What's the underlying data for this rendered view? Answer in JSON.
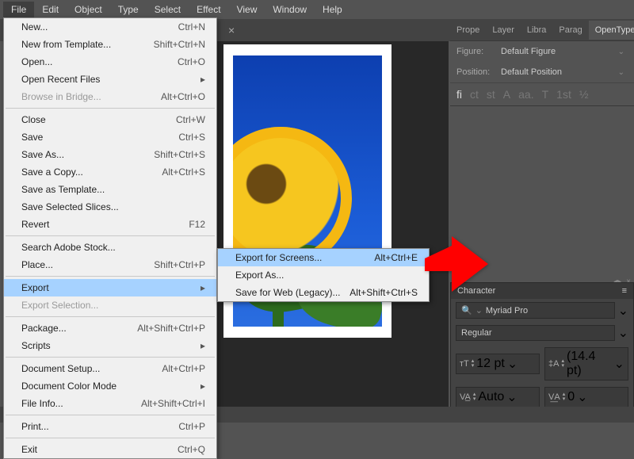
{
  "menubar": [
    "File",
    "Edit",
    "Object",
    "Type",
    "Select",
    "Effect",
    "View",
    "Window",
    "Help"
  ],
  "file_menu": {
    "groups": [
      [
        {
          "label": "New...",
          "short": "Ctrl+N"
        },
        {
          "label": "New from Template...",
          "short": "Shift+Ctrl+N"
        },
        {
          "label": "Open...",
          "short": "Ctrl+O"
        },
        {
          "label": "Open Recent Files",
          "sub": true
        },
        {
          "label": "Browse in Bridge...",
          "short": "Alt+Ctrl+O",
          "disabled": true
        }
      ],
      [
        {
          "label": "Close",
          "short": "Ctrl+W"
        },
        {
          "label": "Save",
          "short": "Ctrl+S"
        },
        {
          "label": "Save As...",
          "short": "Shift+Ctrl+S"
        },
        {
          "label": "Save a Copy...",
          "short": "Alt+Ctrl+S"
        },
        {
          "label": "Save as Template..."
        },
        {
          "label": "Save Selected Slices..."
        },
        {
          "label": "Revert",
          "short": "F12"
        }
      ],
      [
        {
          "label": "Search Adobe Stock..."
        },
        {
          "label": "Place...",
          "short": "Shift+Ctrl+P"
        }
      ],
      [
        {
          "label": "Export",
          "sub": true,
          "hover": true
        },
        {
          "label": "Export Selection...",
          "disabled": true
        }
      ],
      [
        {
          "label": "Package...",
          "short": "Alt+Shift+Ctrl+P"
        },
        {
          "label": "Scripts",
          "sub": true
        }
      ],
      [
        {
          "label": "Document Setup...",
          "short": "Alt+Ctrl+P"
        },
        {
          "label": "Document Color Mode",
          "sub": true
        },
        {
          "label": "File Info...",
          "short": "Alt+Shift+Ctrl+I"
        }
      ],
      [
        {
          "label": "Print...",
          "short": "Ctrl+P"
        }
      ],
      [
        {
          "label": "Exit",
          "short": "Ctrl+Q"
        }
      ]
    ]
  },
  "export_submenu": [
    {
      "label": "Export for Screens...",
      "short": "Alt+Ctrl+E",
      "hover": true
    },
    {
      "label": "Export As..."
    },
    {
      "label": "Save for Web (Legacy)...",
      "short": "Alt+Shift+Ctrl+S"
    }
  ],
  "right_panel": {
    "tabs": [
      "Prope",
      "Layer",
      "Libra",
      "Parag",
      "OpenType"
    ],
    "active_tab": "OpenType",
    "figure_label": "Figure:",
    "figure_value": "Default Figure",
    "position_label": "Position:",
    "position_value": "Default Position",
    "icons": [
      "fi",
      "ct",
      "st",
      "A",
      "aa.",
      "T",
      "1st",
      "½"
    ]
  },
  "char_panel": {
    "title": "Character",
    "font": "Myriad Pro",
    "style": "Regular",
    "size_label": "12 pt",
    "leading_label": "(14.4 pt)",
    "kerning": "Auto",
    "tracking": "0"
  }
}
